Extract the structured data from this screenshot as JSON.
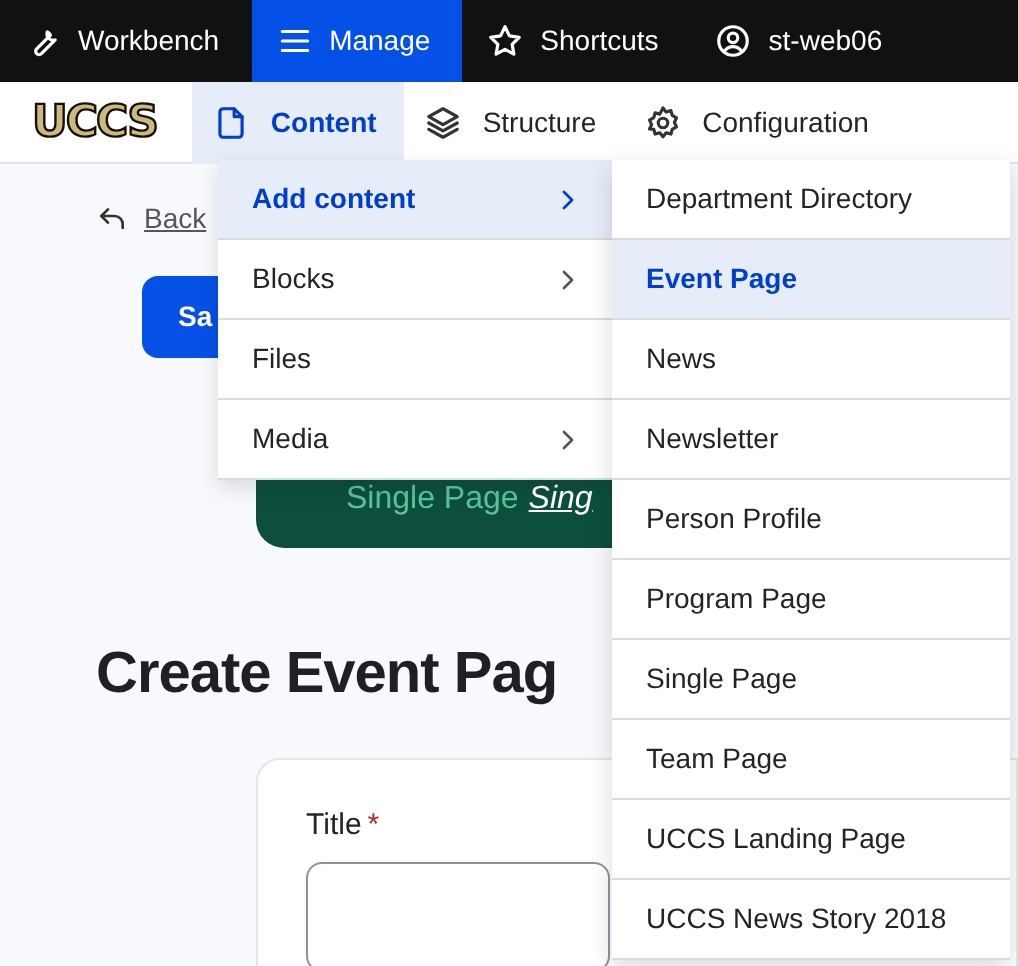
{
  "toolbar": {
    "items": [
      {
        "label": "Workbench",
        "selected": false
      },
      {
        "label": "Manage",
        "selected": true
      },
      {
        "label": "Shortcuts",
        "selected": false
      },
      {
        "label": "st-web06",
        "selected": false
      }
    ]
  },
  "tray": {
    "logo": "UCCS",
    "items": [
      {
        "label": "Content",
        "selected": true
      },
      {
        "label": "Structure",
        "selected": false
      },
      {
        "label": "Configuration",
        "selected": false
      }
    ]
  },
  "content_menu": [
    {
      "label": "Add content",
      "selected": true,
      "submenu": true
    },
    {
      "label": "Blocks",
      "selected": false,
      "submenu": true
    },
    {
      "label": "Files",
      "selected": false,
      "submenu": false
    },
    {
      "label": "Media",
      "selected": false,
      "submenu": true
    }
  ],
  "add_content_menu": [
    {
      "label": "Department Directory",
      "selected": false
    },
    {
      "label": "Event Page",
      "selected": true
    },
    {
      "label": "News",
      "selected": false
    },
    {
      "label": "Newsletter",
      "selected": false
    },
    {
      "label": "Person Profile",
      "selected": false
    },
    {
      "label": "Program Page",
      "selected": false
    },
    {
      "label": "Single Page",
      "selected": false
    },
    {
      "label": "Team Page",
      "selected": false
    },
    {
      "label": "UCCS Landing Page",
      "selected": false
    },
    {
      "label": "UCCS News Story 2018",
      "selected": false
    }
  ],
  "page": {
    "back_link": "Back",
    "save_button": "Sa",
    "message": {
      "text": "Single Page",
      "link": "Sing"
    },
    "heading": "Create Event Pag",
    "form": {
      "title_label": "Title",
      "required_mark": "*"
    }
  }
}
